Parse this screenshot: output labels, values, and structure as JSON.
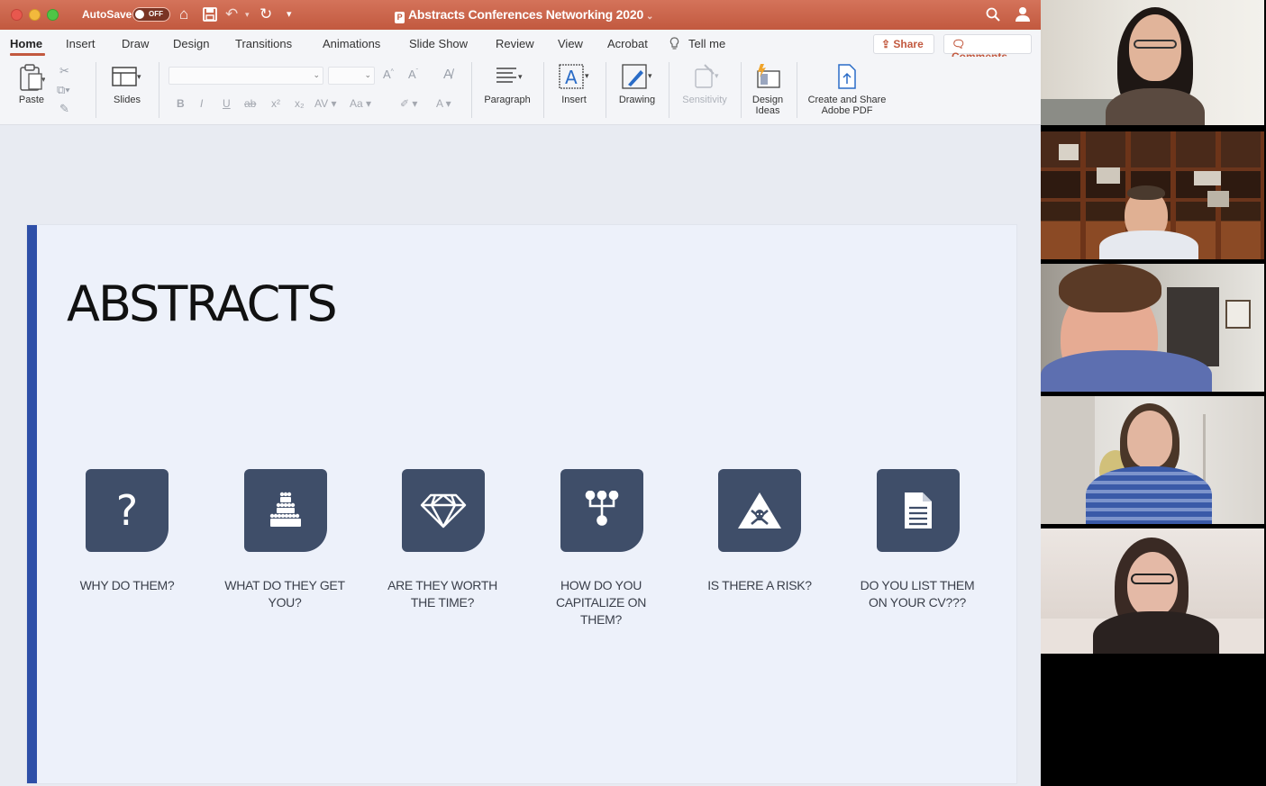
{
  "window": {
    "autosave_label": "AutoSave",
    "autosave_state": "OFF",
    "title": "Abstracts Conferences Networking 2020"
  },
  "tabs": [
    "Home",
    "Insert",
    "Draw",
    "Design",
    "Transitions",
    "Animations",
    "Slide Show",
    "Review",
    "View",
    "Acrobat"
  ],
  "tell_me": "Tell me",
  "share_label": "Share",
  "comments_label": "Comments",
  "ribbon": {
    "paste": "Paste",
    "slides": "Slides",
    "paragraph": "Paragraph",
    "insert": "Insert",
    "drawing": "Drawing",
    "sensitivity": "Sensitivity",
    "design_ideas_1": "Design",
    "design_ideas_2": "Ideas",
    "adobe_1": "Create and Share",
    "adobe_2": "Adobe PDF"
  },
  "slide": {
    "title": "ABSTRACTS",
    "accent_color": "#2e4fa8",
    "card_color": "#3f4e69",
    "cards": [
      {
        "icon": "question-icon",
        "line1": "WHY DO THEM?",
        "line2": "",
        "line3": ""
      },
      {
        "icon": "people-pyramid-icon",
        "line1": "WHAT DO THEY GET",
        "line2": "YOU?",
        "line3": ""
      },
      {
        "icon": "diamond-icon",
        "line1": "ARE THEY WORTH",
        "line2": "THE TIME?",
        "line3": ""
      },
      {
        "icon": "hierarchy-icon",
        "line1": "HOW DO YOU",
        "line2": "CAPITALIZE ON",
        "line3": "THEM?"
      },
      {
        "icon": "hazard-icon",
        "line1": "IS THERE A RISK?",
        "line2": "",
        "line3": ""
      },
      {
        "icon": "document-icon",
        "line1": "DO YOU LIST THEM",
        "line2": "ON YOUR CV???",
        "line3": ""
      }
    ]
  },
  "video_tiles_count": 5
}
